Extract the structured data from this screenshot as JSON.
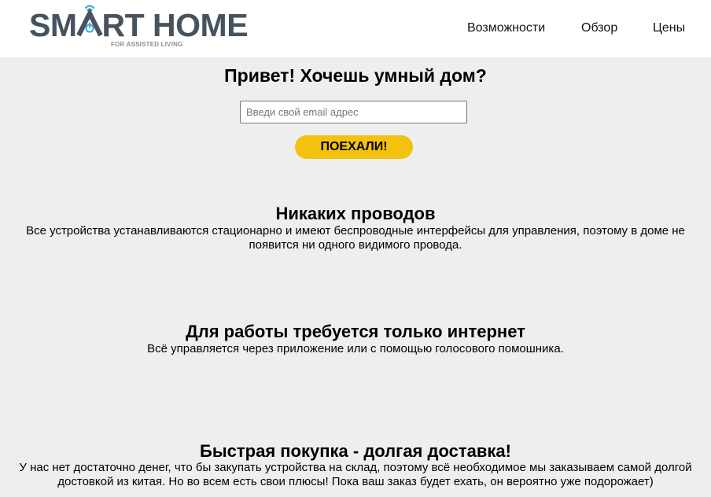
{
  "header": {
    "logo": {
      "title_left": "SM",
      "title_right": "RT HOME",
      "subtitle": "FOR ASSISTED LIVING"
    },
    "nav": [
      {
        "label": "Возможности"
      },
      {
        "label": "Обзор"
      },
      {
        "label": "Цены"
      }
    ]
  },
  "hero": {
    "title": "Привет! Хочешь умный дом?",
    "email_placeholder": "Введи свой email адрес",
    "email_value": "",
    "button_label": "ПОЕХАЛИ!"
  },
  "features": [
    {
      "title": "Никаких проводов",
      "text": "Все устройства устанавливаются стационарно и имеют беспроводные интерфейсы для управления, поэтому в доме не появится ни одного видимого провода."
    },
    {
      "title": "Для работы требуется только интернет",
      "text": "Всё управляется через приложение или с помощью голосового помошника."
    },
    {
      "title": "Быстрая покупка - долгая доставка!",
      "text": "У нас нет достаточно денег, что бы закупать устройства на склад, поэтому всё необходимое мы заказываем самой долгой достовкой из китая. Но во всем есть свои плюсы! Пока ваш заказ будет ехать, он вероятно уже подорожает)"
    }
  ],
  "colors": {
    "page_background": "#eeeeee",
    "header_background": "#ffffff",
    "logo_text": "#46535e",
    "logo_accent": "#3fa9dd",
    "button_background": "#f2c20e"
  },
  "icons": {
    "logo_mark": "house-wifi-power-icon"
  }
}
